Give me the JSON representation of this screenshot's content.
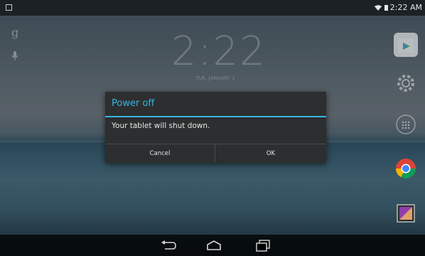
{
  "status_bar": {
    "time": "2:22 AM"
  },
  "lockscreen": {
    "clock": "2:22",
    "date": "TUE, JANUARY 1"
  },
  "dialog": {
    "title": "Power off",
    "message": "Your tablet will shut down.",
    "cancel_label": "Cancel",
    "ok_label": "OK"
  },
  "colors": {
    "accent": "#33b5e5",
    "dialog_bg": "#2d2e2f"
  },
  "icons": {
    "status_left": "notification-icon",
    "wifi": "wifi-icon",
    "battery": "battery-icon",
    "google": "google-search-icon",
    "mic": "mic-icon",
    "dock": [
      "play-store-icon",
      "settings-gear-icon",
      "app-launcher-icon",
      "chrome-icon",
      "gallery-icon"
    ],
    "nav": [
      "back-icon",
      "home-icon",
      "recent-apps-icon"
    ]
  }
}
